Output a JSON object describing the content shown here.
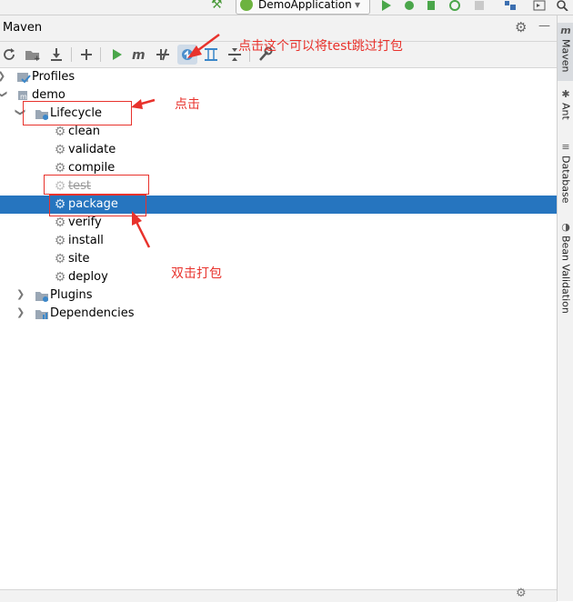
{
  "topbar": {
    "run_config_label": "DemoApplication",
    "run_config_caret": "▾"
  },
  "panel": {
    "title": "Maven",
    "gear": "⚙",
    "minimize": "—"
  },
  "toolbar": {
    "icons": [
      "refresh-icon",
      "add-folder-icon",
      "download-icon",
      "plus-icon",
      "run-icon",
      "maven-m-icon",
      "toggle-offline-icon",
      "skip-tests-icon",
      "show-dependencies-icon",
      "collapse-all-icon",
      "wrench-icon"
    ]
  },
  "tree": {
    "profiles": "Profiles",
    "project": "demo",
    "lifecycle": "Lifecycle",
    "phases": [
      "clean",
      "validate",
      "compile",
      "test",
      "package",
      "verify",
      "install",
      "site",
      "deploy"
    ],
    "plugins": "Plugins",
    "dependencies": "Dependencies"
  },
  "right_tabs": [
    "Maven",
    "Ant",
    "Database",
    "Bean Validation"
  ],
  "annotations": {
    "skip_test": "点击这个可以将test跳过打包",
    "click": "点击",
    "double_click_package": "双击打包"
  },
  "colors": {
    "selection": "#2675bf",
    "annotation": "#e8322c"
  }
}
